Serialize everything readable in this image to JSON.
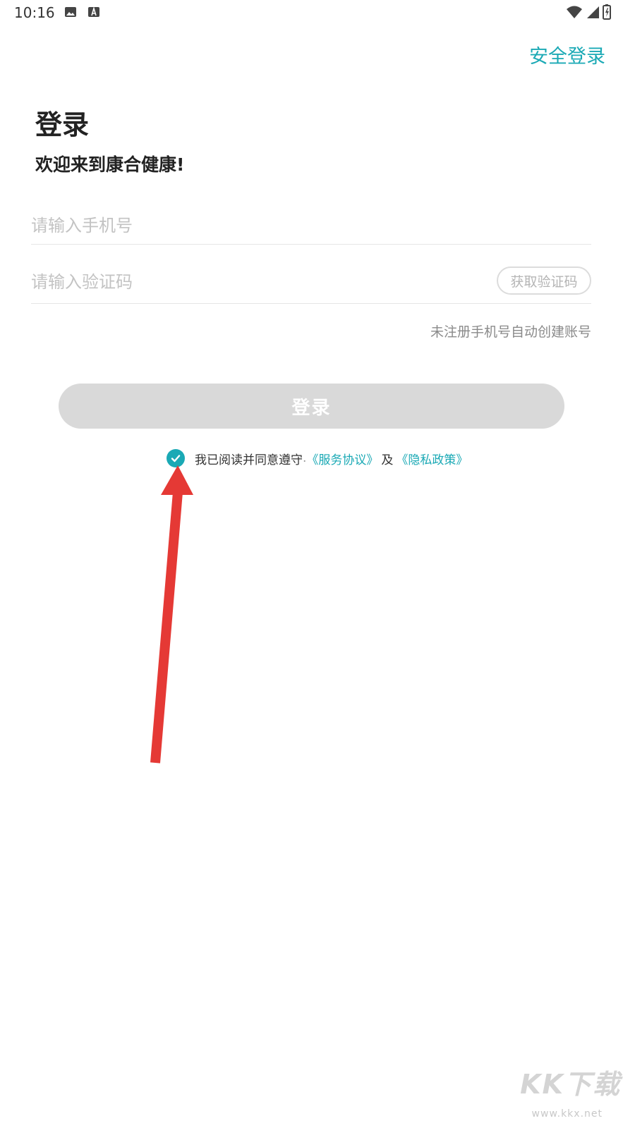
{
  "status_bar": {
    "time": "10:16",
    "left_icons": [
      "image-icon",
      "a-icon"
    ],
    "right_icons": [
      "wifi-icon",
      "signal-icon",
      "battery-icon"
    ]
  },
  "header": {
    "secure_login": "安全登录"
  },
  "page": {
    "title": "登录",
    "welcome": "欢迎来到康合健康!"
  },
  "form": {
    "phone_placeholder": "请输入手机号",
    "code_placeholder": "请输入验证码",
    "get_code_label": "获取验证码",
    "note": "未注册手机号自动创建账号",
    "login_button": "登录"
  },
  "agreement": {
    "checked": true,
    "text": "我已阅读并同意遵守",
    "dot": ".",
    "service_link": "《服务协议》",
    "and": "及",
    "privacy_link": "《隐私政策》"
  },
  "watermark": {
    "brand": "KK下载",
    "url": "www.kkx.net"
  },
  "colors": {
    "accent": "#1aa9b5",
    "disabled_button": "#d9d9d9",
    "annotation_arrow": "#e53935"
  }
}
